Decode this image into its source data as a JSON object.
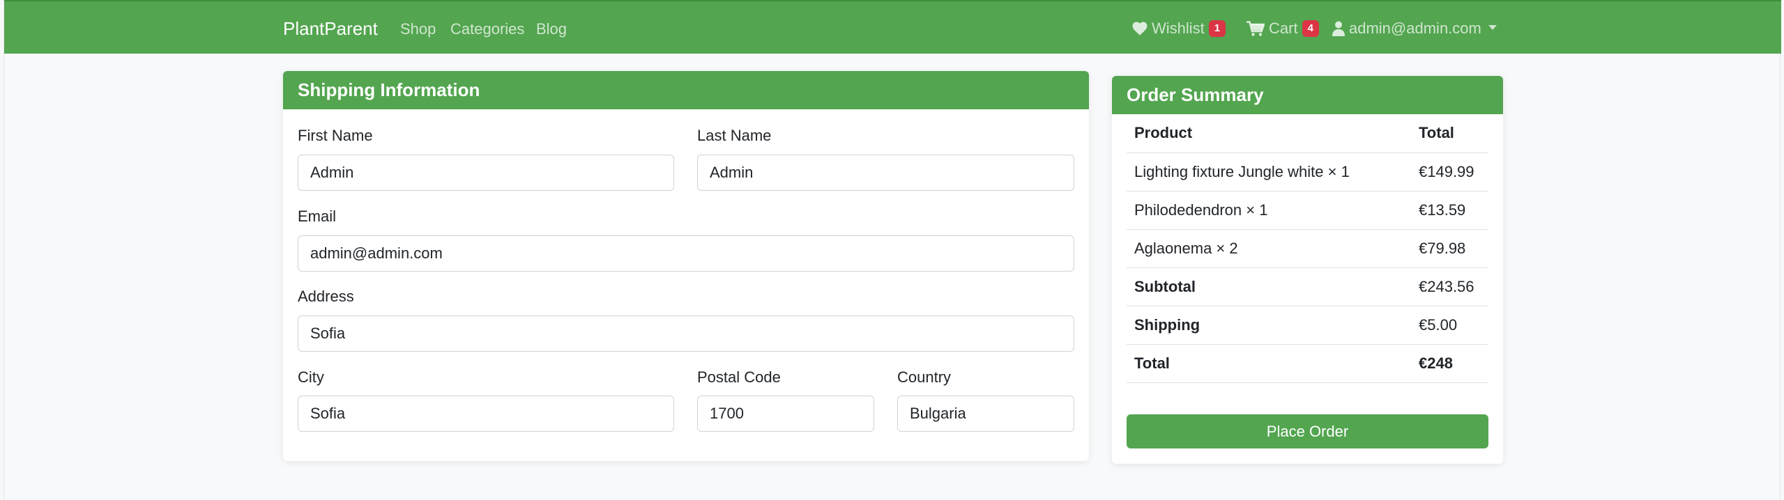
{
  "navbar": {
    "brand": "PlantParent",
    "links": [
      {
        "label": "Shop"
      },
      {
        "label": "Categories"
      },
      {
        "label": "Blog"
      }
    ],
    "wishlist": {
      "label": "Wishlist",
      "count": "1"
    },
    "cart": {
      "label": "Cart",
      "count": "4"
    },
    "user": {
      "label": "admin@admin.com"
    }
  },
  "shipping": {
    "title": "Shipping Information",
    "first_name": {
      "label": "First Name",
      "value": "Admin"
    },
    "last_name": {
      "label": "Last Name",
      "value": "Admin"
    },
    "email": {
      "label": "Email",
      "value": "admin@admin.com"
    },
    "address": {
      "label": "Address",
      "value": "Sofia"
    },
    "city": {
      "label": "City",
      "value": "Sofia"
    },
    "postal_code": {
      "label": "Postal Code",
      "value": "1700"
    },
    "country": {
      "label": "Country",
      "value": "Bulgaria"
    }
  },
  "summary": {
    "title": "Order Summary",
    "headers": {
      "product": "Product",
      "total": "Total"
    },
    "items": [
      {
        "product": "Lighting fixture Jungle white × 1",
        "total": "€149.99"
      },
      {
        "product": "Philodedendron × 1",
        "total": "€13.59"
      },
      {
        "product": "Aglaonema × 2",
        "total": "€79.98"
      }
    ],
    "subtotal": {
      "label": "Subtotal",
      "value": "€243.56"
    },
    "shipping": {
      "label": "Shipping",
      "value": "€5.00"
    },
    "total": {
      "label": "Total",
      "value": "€248"
    },
    "place_order": "Place Order"
  },
  "colors": {
    "brand_green": "#53a550",
    "badge_red": "#dc3545"
  },
  "icons": {
    "wishlist": "heart-icon",
    "cart": "cart-icon",
    "user": "user-icon",
    "dropdown": "chevron-down-icon"
  }
}
